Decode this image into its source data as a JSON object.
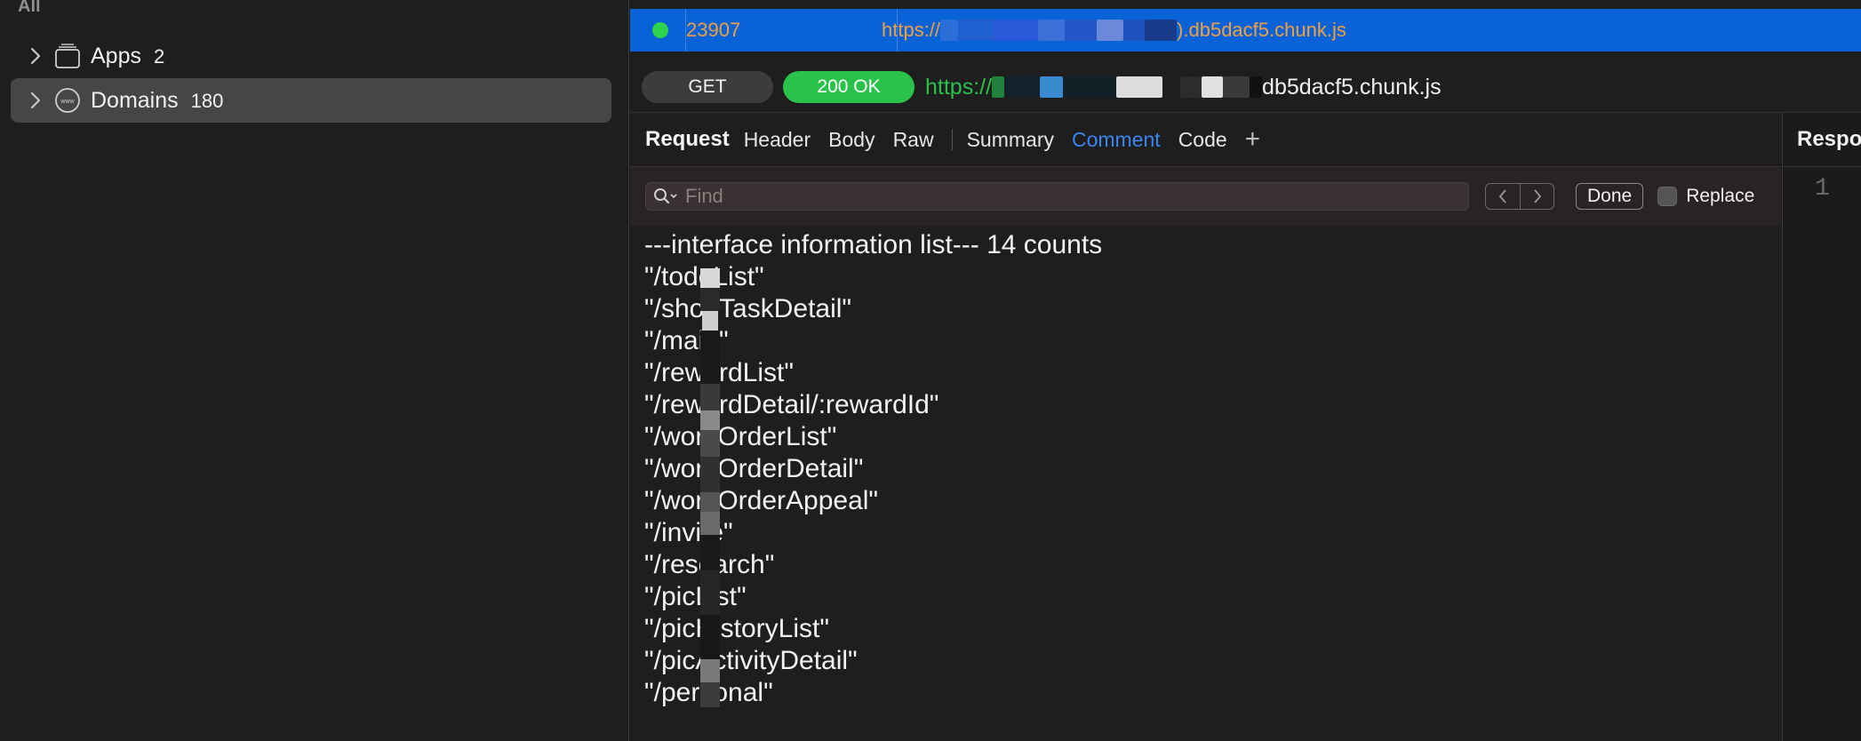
{
  "sidebar": {
    "section_label": "All",
    "items": [
      {
        "label": "Apps",
        "count": "2",
        "icon": "folder-icon",
        "selected": false
      },
      {
        "label": "Domains",
        "count": "180",
        "icon": "www-globe-icon",
        "selected": true
      }
    ]
  },
  "selected_row": {
    "status_color": "#2fd24b",
    "id": "23907",
    "url_prefix": "https://",
    "url_suffix": ").db5dacf5.chunk.js"
  },
  "request_bar": {
    "method": "GET",
    "status": "200 OK",
    "url_prefix": "https://",
    "url_suffix": "db5dacf5.chunk.js"
  },
  "tabs": {
    "title": "Request",
    "items": [
      "Header",
      "Body",
      "Raw"
    ],
    "items2": [
      "Summary",
      "Comment",
      "Code"
    ],
    "active": "Comment",
    "add": "+"
  },
  "find": {
    "placeholder": "Find",
    "done_label": "Done",
    "replace_label": "Replace"
  },
  "comment_lines": [
    "---interface information list--- 14 counts",
    "\"/todoList\"",
    "\"/shopTaskDetail\"",
    "\"/main\"",
    "\"/rewardList\"",
    "\"/rewardDetail/:rewardId\"",
    "\"/workOrderList\"",
    "\"/workOrderDetail\"",
    "\"/workOrderAppeal\"",
    "\"/invite\"",
    "\"/research\"",
    "\"/picList\"",
    "\"/picHistoryList\"",
    "\"/picActivityDetail\"",
    "\"/personal\""
  ],
  "response": {
    "title": "Response",
    "line_number": "1"
  },
  "colors": {
    "accent_blue": "#0a63d6",
    "ok_green": "#2ac24b",
    "url_orange": "#f0a040",
    "tab_active": "#3a86f0"
  }
}
